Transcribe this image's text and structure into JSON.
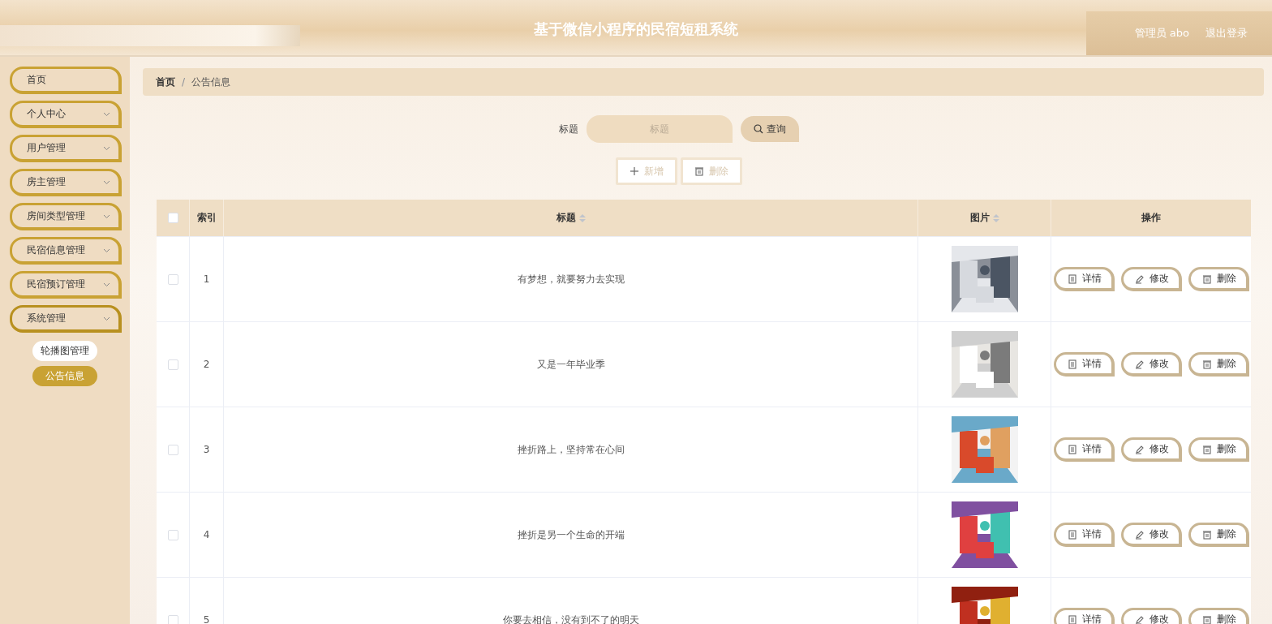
{
  "header": {
    "title": "基于微信小程序的民宿短租系统",
    "user": "管理员 abo",
    "logout": "退出登录"
  },
  "sidebar": {
    "items": [
      {
        "label": "首页",
        "kind": "link"
      },
      {
        "label": "个人中心",
        "kind": "group",
        "expanded": false
      },
      {
        "label": "用户管理",
        "kind": "group",
        "expanded": false
      },
      {
        "label": "房主管理",
        "kind": "group",
        "expanded": false
      },
      {
        "label": "房间类型管理",
        "kind": "group",
        "expanded": false
      },
      {
        "label": "民宿信息管理",
        "kind": "group",
        "expanded": false
      },
      {
        "label": "民宿预订管理",
        "kind": "group",
        "expanded": false
      },
      {
        "label": "系统管理",
        "kind": "group",
        "expanded": true,
        "children": [
          {
            "label": "轮播图管理",
            "selected": false
          },
          {
            "label": "公告信息",
            "selected": true
          }
        ]
      }
    ]
  },
  "breadcrumb": {
    "separator": "/",
    "items": [
      "首页",
      "公告信息"
    ]
  },
  "search": {
    "label": "标题",
    "placeholder": "标题",
    "button": "查询"
  },
  "actions": [
    {
      "label": "新增",
      "kind": "add",
      "disabled": true
    },
    {
      "label": "删除",
      "kind": "delete",
      "disabled": true
    }
  ],
  "table": {
    "select_all": {
      "checked": false
    },
    "columns": [
      {
        "label": "索引",
        "sortable": false
      },
      {
        "label": "标题",
        "sortable": true
      },
      {
        "label": "图片",
        "sortable": true
      },
      {
        "label": "操作",
        "sortable": false
      }
    ],
    "rows": [
      {
        "checked": false,
        "index": "1",
        "title": "有梦想，就要努力去实现",
        "image": {
          "kind": "picture"
        },
        "ops": [
          "详情",
          "修改",
          "删除"
        ]
      },
      {
        "checked": false,
        "index": "2",
        "title": "又是一年毕业季",
        "image": {
          "kind": "picture"
        },
        "ops": [
          "详情",
          "修改",
          "删除"
        ]
      },
      {
        "checked": false,
        "index": "3",
        "title": "挫折路上，坚持常在心间",
        "image": {
          "kind": "picture"
        },
        "ops": [
          "详情",
          "修改",
          "删除"
        ]
      },
      {
        "checked": false,
        "index": "4",
        "title": "挫折是另一个生命的开端",
        "image": {
          "kind": "picture"
        },
        "ops": [
          "详情",
          "修改",
          "删除"
        ]
      },
      {
        "checked": false,
        "index": "5",
        "title": "你要去相信，没有到不了的明天",
        "image": {
          "kind": "picture"
        },
        "ops": [
          "详情",
          "修改",
          "删除"
        ]
      }
    ]
  }
}
